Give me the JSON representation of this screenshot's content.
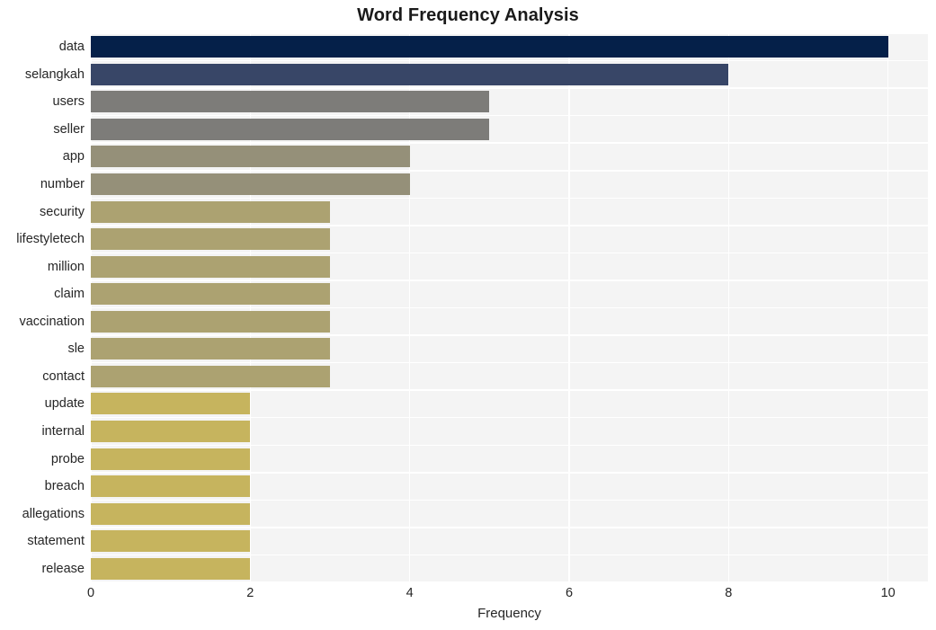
{
  "chart_data": {
    "type": "bar",
    "orientation": "horizontal",
    "title": "Word Frequency Analysis",
    "xlabel": "Frequency",
    "ylabel": "",
    "xlim": [
      0,
      10.5
    ],
    "xticks": [
      0,
      2,
      4,
      6,
      8,
      10
    ],
    "grid": true,
    "legend": false,
    "categories": [
      "data",
      "selangkah",
      "users",
      "seller",
      "app",
      "number",
      "security",
      "lifestyletech",
      "million",
      "claim",
      "vaccination",
      "sle",
      "contact",
      "update",
      "internal",
      "probe",
      "breach",
      "allegations",
      "statement",
      "release"
    ],
    "values": [
      10,
      8,
      5,
      5,
      4,
      4,
      3,
      3,
      3,
      3,
      3,
      3,
      3,
      2,
      2,
      2,
      2,
      2,
      2,
      2
    ],
    "bar_colors": [
      "#052049",
      "#384667",
      "#7d7c79",
      "#7d7c79",
      "#959079",
      "#959079",
      "#aca271",
      "#aca271",
      "#aca271",
      "#aca271",
      "#aca271",
      "#aca271",
      "#aca271",
      "#c6b45e",
      "#c6b45e",
      "#c6b45e",
      "#c6b45e",
      "#c6b45e",
      "#c6b45e",
      "#c6b45e"
    ]
  },
  "style": {
    "plot_background": "#f4f4f4",
    "grid_color": "#ffffff",
    "page_background": "#ffffff",
    "text_color": "#262626"
  }
}
